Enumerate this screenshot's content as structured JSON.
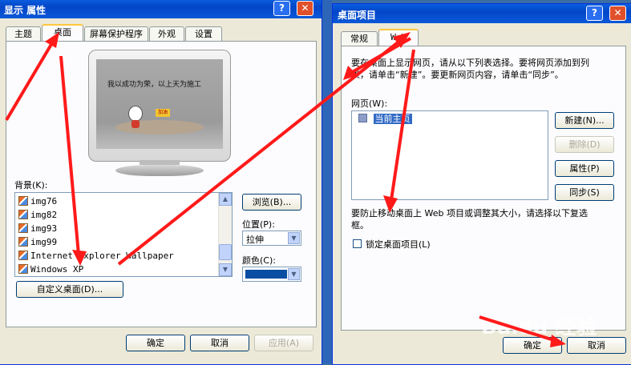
{
  "display_props": {
    "title": "显示 属性",
    "help_btn": "?",
    "close_btn": "✕",
    "tabs": [
      {
        "label": "主题"
      },
      {
        "label": "桌面"
      },
      {
        "label": "屏幕保护程序"
      },
      {
        "label": "外观"
      },
      {
        "label": "设置"
      }
    ],
    "active_tab": "桌面",
    "preview_text": "我以成功为荣，以上天为施工",
    "preview_sign": "加油",
    "background_label": "背景(K):",
    "backgrounds": [
      {
        "label": "img76"
      },
      {
        "label": "img82"
      },
      {
        "label": "img93"
      },
      {
        "label": "img99"
      },
      {
        "label": "Internet Explorer Wallpaper"
      },
      {
        "label": "Windows XP"
      }
    ],
    "browse_btn": "浏览(B)...",
    "position_label": "位置(P):",
    "position_value": "拉伸",
    "color_label": "颜色(C):",
    "color_value": "#0a4ea3",
    "customize_btn": "自定义桌面(D)...",
    "ok_btn": "确定",
    "cancel_btn": "取消",
    "apply_btn": "应用(A)"
  },
  "desktop_items": {
    "title": "桌面项目",
    "help_btn": "?",
    "close_btn": "✕",
    "tabs": [
      {
        "label": "常规"
      },
      {
        "label": "Web"
      }
    ],
    "active_tab": "Web",
    "description_line1": "要在桌面上显示网页，请从以下列表选择。要将网页添加到列",
    "description_line2": "表，请单击“新建”。要更新网页内容，请单击“同步”。",
    "webpages_label": "网页(W):",
    "webpages": [
      {
        "label": "当前主页"
      }
    ],
    "new_btn": "新建(N)...",
    "delete_btn": "删除(D)",
    "properties_btn": "属性(P)",
    "sync_btn": "同步(S)",
    "lock_hint_line1": "要防止移动桌面上 Web 项目或调整其大小，请选择以下复选",
    "lock_hint_line2": "框。",
    "lock_label": "锁定桌面项目(L)",
    "lock_checked": false,
    "ok_btn": "确定",
    "cancel_btn": "取消"
  },
  "watermark": "Baidu 经验",
  "colors": {
    "annotation": "#ff1a1a",
    "title_bar": "#0346c8",
    "selection": "#316ac5"
  }
}
